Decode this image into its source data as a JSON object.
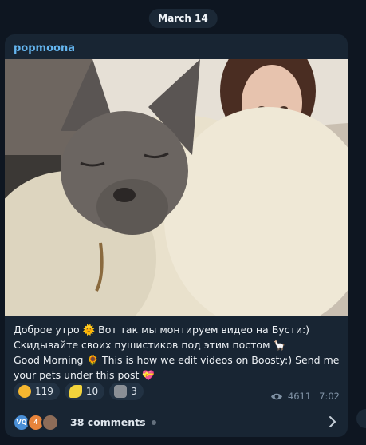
{
  "date_label": "March 14",
  "post": {
    "channel_name": "popmoona",
    "text_lines": [
      "Доброе утро 🌞 Вот так мы монтируем видео на Бусти:)",
      "Скидывайте своих пушистиков под этим постом 🦙",
      "Good Morning 🌻  This is how we edit videos on Boosty:) Send me",
      "your pets under this post 💝"
    ],
    "reactions": [
      {
        "emoji": "heart-eyes-emoji",
        "count": "119"
      },
      {
        "emoji": "banana-emoji",
        "count": "10"
      },
      {
        "emoji": "moai-emoji",
        "count": "3"
      }
    ],
    "views": "4611",
    "time": "7:02",
    "comments": {
      "label": "38 comments",
      "avatars": [
        {
          "initials": "VQ",
          "color": "#4a8fd6"
        },
        {
          "initials": "4",
          "color": "#e7843b"
        },
        {
          "initials": "",
          "color": "#8d6c58"
        }
      ]
    }
  },
  "colors": {
    "background": "#0e1621",
    "card": "#182533",
    "accent": "#64b5ef"
  }
}
